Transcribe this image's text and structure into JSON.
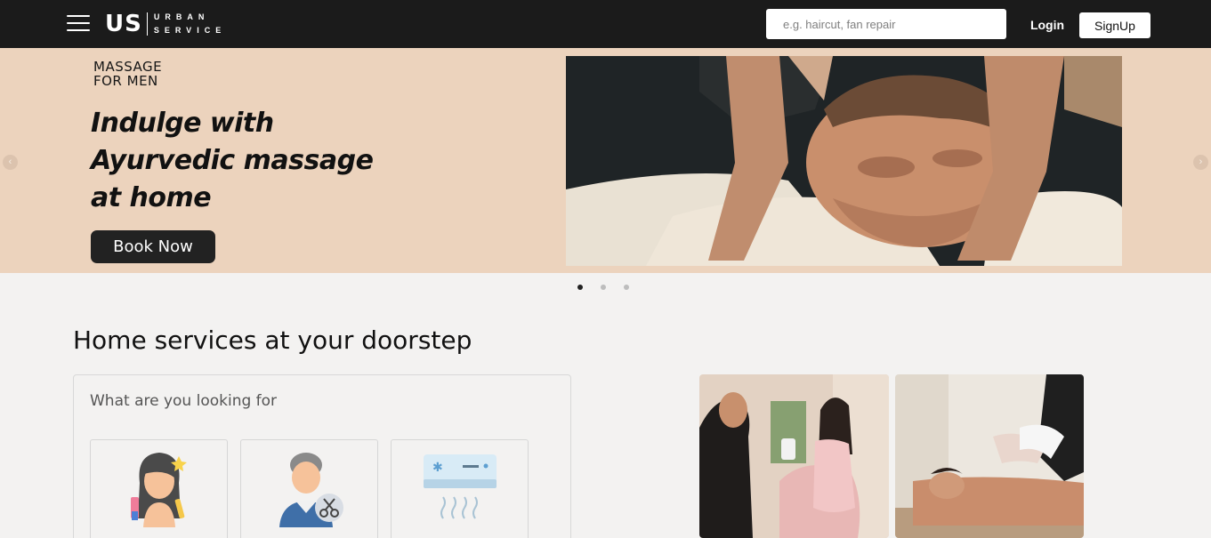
{
  "header": {
    "logo_mark": "US",
    "logo_word_1": "URBAN",
    "logo_word_2": "SERVICE",
    "search_placeholder": "e.g. haircut, fan repair",
    "login_label": "Login",
    "signup_label": "SignUp"
  },
  "hero": {
    "tag_line_1": "MASSAGE",
    "tag_line_2": "FOR MEN",
    "title_line_1": "Indulge with",
    "title_line_2": "Ayurvedic massage",
    "title_line_3": "at home",
    "book_label": "Book Now",
    "prev_icon": "‹",
    "next_icon": "›",
    "slides_count": 3,
    "active_slide": 1
  },
  "main": {
    "section_title": "Home services at your doorstep",
    "card_heading": "What are you looking for"
  },
  "colors": {
    "navbar": "#1b1b1b",
    "hero_bg": "#ecd3bd",
    "page_bg": "#f3f2f1"
  }
}
